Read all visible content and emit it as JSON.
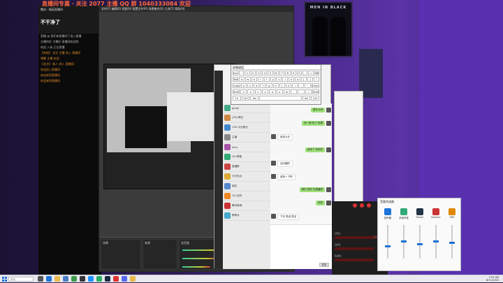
{
  "overlay": {
    "text": "直播间专属 · 关注 2077 主播 QQ 群 1040333084 欢迎"
  },
  "left_panel": {
    "title": "不干净了",
    "header_name": "糯米 - 精英直播间",
    "chat": [
      "直播 @ 我们来直播间了进入直播",
      "主播你好 主播好 直播间欢迎你",
      "欢迎 入场 正在直播",
      "【系统】 关注 主播 进入 直播间",
      "弹幕 主播 欢迎",
      "【关注】 新人 进入 直播间",
      "欢迎进入直播间",
      "欢迎来到直播间",
      "欢迎来到直播间"
    ]
  },
  "obs": {
    "menu": "文件(F)  编辑(E)  视图(V)  配置文件(P)  场景集合(S)  工具(T)  帮助(H)",
    "docks": [
      "场景",
      "来源",
      "混音器",
      "转场"
    ]
  },
  "qq": {
    "title": "发送快捷键",
    "contacts": [
      {
        "name": "gmail",
        "color": "#4a8"
      },
      {
        "name": "[1ft] 晴空",
        "color": "#c84"
      },
      {
        "name": "CSS-今日看点",
        "color": "#48c"
      },
      {
        "name": "主播",
        "color": "#888"
      },
      {
        "name": "alice",
        "color": "#a5a"
      },
      {
        "name": "QQ 邮箱",
        "color": "#3a7"
      },
      {
        "name": "直播群",
        "color": "#c44"
      },
      {
        "name": "今日热点",
        "color": "#da3"
      },
      {
        "name": "朋友",
        "color": "#58c"
      },
      {
        "name": "QQ 空间",
        "color": "#e82"
      },
      {
        "name": "腾讯新闻",
        "color": "#c33"
      },
      {
        "name": "群助手",
        "color": "#4ac"
      }
    ],
    "messages": [
      {
        "from": "me",
        "text": "是什么呀"
      },
      {
        "from": "me",
        "text": "好一般 听了 好棒"
      },
      {
        "from": "other",
        "text": "我怎么办"
      },
      {
        "from": "me",
        "text": "我来了 你好好"
      },
      {
        "from": "other",
        "text": "没问题的"
      },
      {
        "from": "other",
        "text": "收到一下吧"
      },
      {
        "from": "me",
        "text": "我们 现在 在直播呢"
      },
      {
        "from": "me",
        "text": "好的"
      },
      {
        "from": "other",
        "text": "下次 再说 再见"
      }
    ],
    "send_label": "发送"
  },
  "keyboard": {
    "title": "屏幕键盘",
    "rows": [
      [
        "Esc",
        "`",
        "1",
        "2",
        "3",
        "4",
        "5",
        "6",
        "7",
        "8",
        "9",
        "0",
        "-",
        "=",
        "⌫"
      ],
      [
        "Tab",
        "q",
        "w",
        "e",
        "r",
        "t",
        "y",
        "u",
        "i",
        "o",
        "p",
        "[",
        "]",
        "\\"
      ],
      [
        "Caps",
        "a",
        "s",
        "d",
        "f",
        "g",
        "h",
        "j",
        "k",
        "l",
        ";",
        "'",
        "Enter"
      ],
      [
        "Shift",
        "z",
        "x",
        "c",
        "v",
        "b",
        "n",
        "m",
        ",",
        ".",
        "/",
        "Shift"
      ],
      [
        "Fn",
        "Ctrl",
        "Alt",
        "",
        "Alt",
        "Ctrl"
      ]
    ]
  },
  "hw_monitor": {
    "rows": [
      {
        "label": "CPU",
        "value": "1080MHz"
      },
      {
        "label": "GPU",
        "value": "64°C"
      },
      {
        "label": "RAM",
        "value": "64°C"
      }
    ]
  },
  "mixer": {
    "title": "音量合成器",
    "columns": [
      {
        "label": "扬声器",
        "color": "#1e73d8",
        "level": 0.4
      },
      {
        "label": "系统声音",
        "color": "#3a7",
        "level": 0.55
      },
      {
        "label": "Steam",
        "color": "#234",
        "level": 0.45
      },
      {
        "label": "Nahimic",
        "color": "#c33",
        "level": 0.55
      },
      {
        "label": "OBS",
        "color": "#d80",
        "level": 0.5
      }
    ]
  },
  "taskbar": {
    "search_placeholder": "搜索",
    "clock_time": "7:53 AM",
    "clock_date": "8/11/2020",
    "icons": [
      {
        "name": "task-view-icon",
        "color": "#555"
      },
      {
        "name": "edge-icon",
        "color": "#1e73d8"
      },
      {
        "name": "file-explorer-icon",
        "color": "#e8b84a"
      },
      {
        "name": "store-icon",
        "color": "#4a7cc4"
      },
      {
        "name": "chrome-icon",
        "color": "#3c9b4a"
      },
      {
        "name": "obs-icon",
        "color": "#333"
      },
      {
        "name": "qq-icon",
        "color": "#1e90ff"
      },
      {
        "name": "wechat-icon",
        "color": "#2aae67"
      },
      {
        "name": "steam-icon",
        "color": "#1a2a40"
      },
      {
        "name": "music-icon",
        "color": "#d33"
      },
      {
        "name": "discord-icon",
        "color": "#5865f2"
      },
      {
        "name": "folder-icon",
        "color": "#e8b84a"
      }
    ]
  }
}
